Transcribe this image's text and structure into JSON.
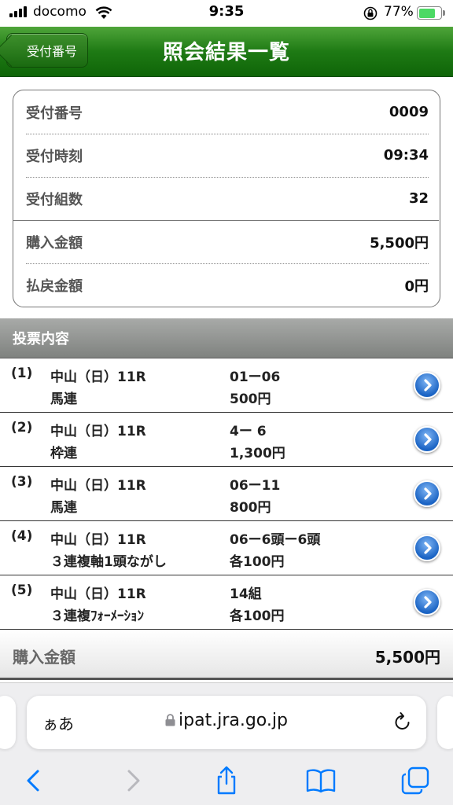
{
  "status_bar": {
    "carrier": "docomo",
    "time": "9:35",
    "battery": "77%"
  },
  "header": {
    "back_label": "受付番号",
    "title": "照会結果一覧"
  },
  "summary": [
    {
      "label": "受付番号",
      "value": "0009"
    },
    {
      "label": "受付時刻",
      "value": "09:34"
    },
    {
      "label": "受付組数",
      "value": "32"
    },
    {
      "label": "購入金額",
      "value": "5,500円"
    },
    {
      "label": "払戻金額",
      "value": "0円"
    }
  ],
  "section_title": "投票内容",
  "bets": [
    {
      "num": "(1)",
      "venue": "中山（日）11R",
      "type": "馬連",
      "combo": "01ー06",
      "amount": "500円"
    },
    {
      "num": "(2)",
      "venue": "中山（日）11R",
      "type": "枠連",
      "combo": "4ー 6",
      "amount": "1,300円"
    },
    {
      "num": "(3)",
      "venue": "中山（日）11R",
      "type": "馬連",
      "combo": "06ー11",
      "amount": "800円"
    },
    {
      "num": "(4)",
      "venue": "中山（日）11R",
      "type": "３連複軸1頭ながし",
      "combo": "06ー6頭ー6頭",
      "amount": "各100円"
    },
    {
      "num": "(5)",
      "venue": "中山（日）11R",
      "type": "３連複ﾌｫｰﾒｰｼｮﾝ",
      "combo": "14組",
      "amount": "各100円"
    }
  ],
  "total": {
    "label": "購入金額",
    "value": "5,500円"
  },
  "browser": {
    "aa_label": "ぁあ",
    "url": "ipat.jra.go.jp"
  },
  "colors": {
    "header_green": "#1e7a14",
    "link_blue": "#1b64c4",
    "ios_blue": "#007aff"
  }
}
